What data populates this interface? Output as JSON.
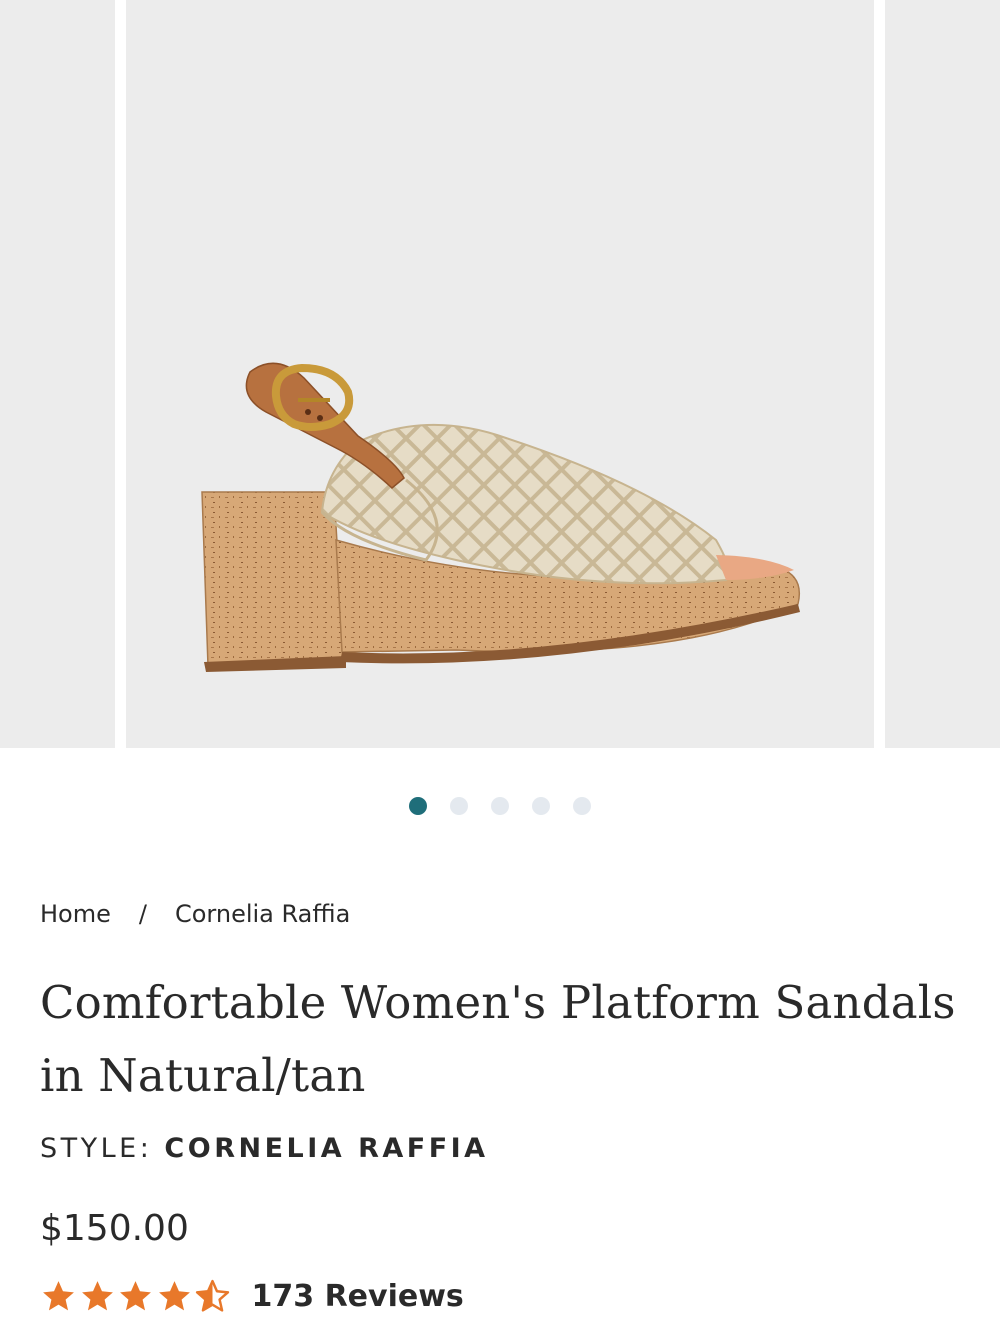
{
  "gallery": {
    "zoom_icon": "magnifier-icon",
    "slide_count": 5,
    "active_slide": 1
  },
  "breadcrumb": {
    "home": "Home",
    "separator": "/",
    "current": "Cornelia Raffia"
  },
  "product": {
    "title": "Comfortable Women's Platform Sandals in Natural/tan",
    "style_label": "STYLE:",
    "style_value": "CORNELIA RAFFIA",
    "price": "$150.00",
    "rating": 4.5,
    "reviews_label": "173 Reviews"
  },
  "colors": {
    "accent_dot": "#1f6e7a",
    "star": "#e8782a",
    "background_image": "#ececec"
  }
}
